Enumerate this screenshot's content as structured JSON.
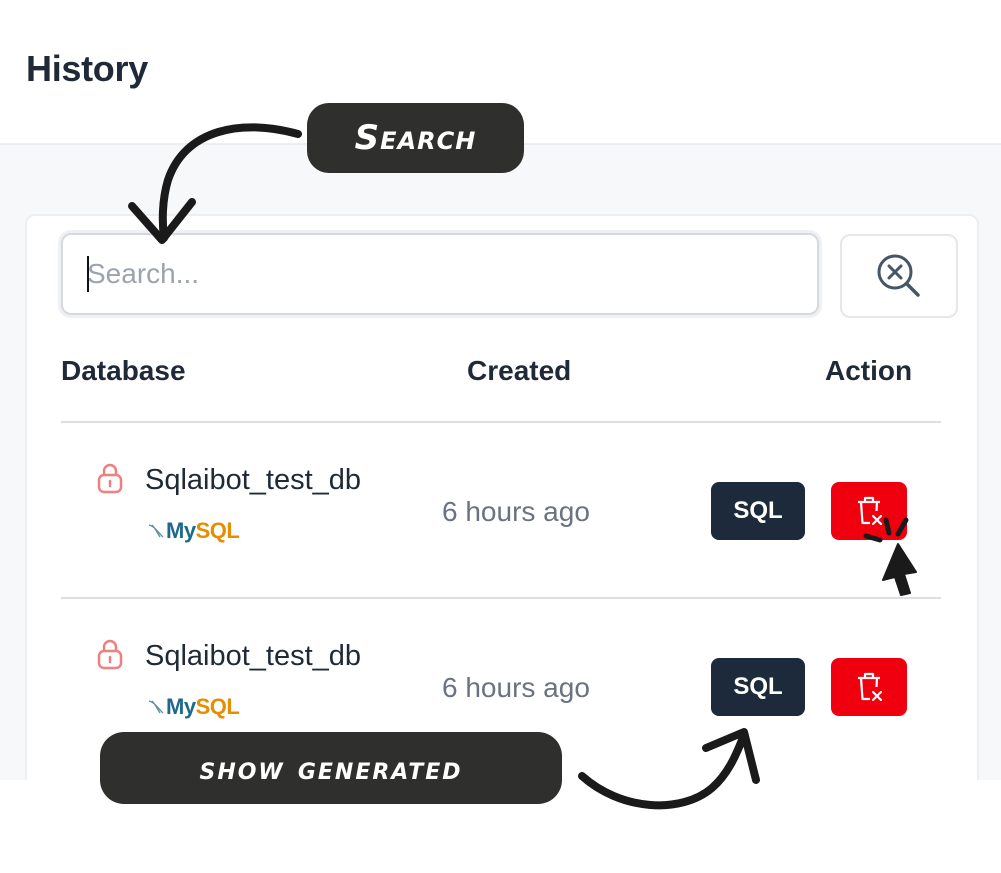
{
  "header": {
    "title": "History"
  },
  "search": {
    "placeholder": "Search..."
  },
  "table": {
    "columns": [
      "Database",
      "Created",
      "Action"
    ],
    "rows": [
      {
        "name": "Sqlaibot_test_db",
        "db_type_a": "My",
        "db_type_b": "SQL",
        "created": "6 hours ago",
        "sql_label": "SQL"
      },
      {
        "name": "Sqlaibot_test_db",
        "db_type_a": "My",
        "db_type_b": "SQL",
        "created": "6 hours ago",
        "sql_label": "SQL"
      }
    ]
  },
  "annotations": {
    "search_callout": "Search",
    "show_callout": "show generated"
  },
  "colors": {
    "dark_button": "#1c2a3b",
    "delete_button": "#f0000f",
    "lock_icon": "#f08080",
    "mysql_blue": "#1d6a8e",
    "mysql_orange": "#e48e00"
  },
  "icons": {
    "clear_search": "search-x-icon",
    "lock": "lock-icon",
    "delete": "trash-x-icon",
    "db_logo": "mysql-dolphin-icon"
  }
}
